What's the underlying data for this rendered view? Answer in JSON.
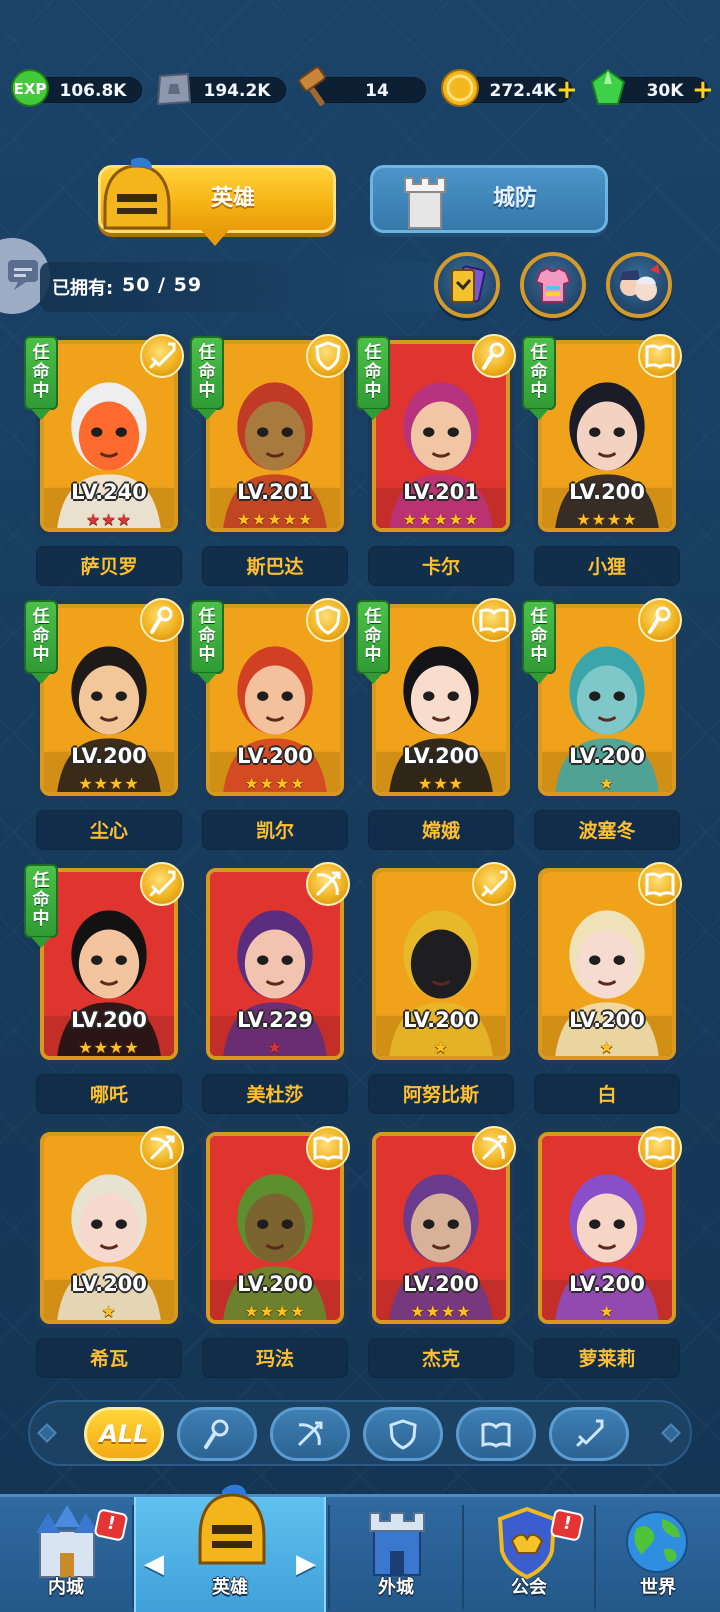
{
  "resources": [
    {
      "id": "exp",
      "value": "106.8K",
      "plus": false,
      "color": "#4fd43a"
    },
    {
      "id": "stone",
      "value": "194.2K",
      "plus": false,
      "color": "#9aa4b8"
    },
    {
      "id": "hammer",
      "value": "14",
      "plus": false,
      "color": "#c8863a"
    },
    {
      "id": "gold",
      "value": "272.4K",
      "plus": true,
      "color": "#f2b81e"
    },
    {
      "id": "gem",
      "value": "30K",
      "plus": true,
      "color": "#3fd04a"
    }
  ],
  "plus_symbol": "+",
  "tabs": {
    "heroes": "英雄",
    "defense": "城防"
  },
  "owned": {
    "label": "已拥有:",
    "value": "50 / 59"
  },
  "appointed_label": "任命中",
  "star_glyph": "★",
  "heroes": [
    {
      "name": "萨贝罗",
      "level": "LV.240",
      "stars": 3,
      "star_color": "#e0303c",
      "class": "sword",
      "appointed": true,
      "bg": "#f0a31a",
      "skin": "#ff6a2e",
      "hair": "#eeeeee"
    },
    {
      "name": "斯巴达",
      "level": "LV.201",
      "stars": 5,
      "star_color": "#ffc21a",
      "class": "shield",
      "appointed": true,
      "bg": "#f0a31a",
      "skin": "#a87a3e",
      "hair": "#c03a26"
    },
    {
      "name": "卡尔",
      "level": "LV.201",
      "stars": 5,
      "star_color": "#ffc21a",
      "class": "staff",
      "appointed": true,
      "bg": "#e0352e",
      "skin": "#f0c6a4",
      "hair": "#b8337e"
    },
    {
      "name": "小狸",
      "level": "LV.200",
      "stars": 4,
      "star_color": "#ffc21a",
      "class": "book",
      "appointed": true,
      "bg": "#f0a31a",
      "skin": "#f4d2c2",
      "hair": "#1c1c28"
    },
    {
      "name": "尘心",
      "level": "LV.200",
      "stars": 4,
      "star_color": "#ffc21a",
      "class": "staff",
      "appointed": true,
      "bg": "#f0a31a",
      "skin": "#f2c79a",
      "hair": "#1e1a18"
    },
    {
      "name": "凯尔",
      "level": "LV.200",
      "stars": 4,
      "star_color": "#ffc21a",
      "class": "shield",
      "appointed": true,
      "bg": "#f0a31a",
      "skin": "#f3c29c",
      "hair": "#d24024"
    },
    {
      "name": "嫦娥",
      "level": "LV.200",
      "stars": 3,
      "star_color": "#ffc21a",
      "class": "book",
      "appointed": true,
      "bg": "#f0a31a",
      "skin": "#f8dccc",
      "hair": "#141418"
    },
    {
      "name": "波塞冬",
      "level": "LV.200",
      "stars": 1,
      "star_color": "#ffc21a",
      "class": "staff",
      "appointed": true,
      "bg": "#f0a31a",
      "skin": "#7fc7c8",
      "hair": "#3aa6ac"
    },
    {
      "name": "哪吒",
      "level": "LV.200",
      "stars": 4,
      "star_color": "#ffc21a",
      "class": "sword",
      "appointed": true,
      "bg": "#e0352e",
      "skin": "#f4c49e",
      "hair": "#121212"
    },
    {
      "name": "美杜莎",
      "level": "LV.229",
      "stars": 1,
      "star_color": "#e0303c",
      "class": "bow",
      "appointed": false,
      "bg": "#e0352e",
      "skin": "#f2c4b0",
      "hair": "#5a2d7e"
    },
    {
      "name": "阿努比斯",
      "level": "LV.200",
      "stars": 1,
      "star_color": "#ffc21a",
      "class": "sword",
      "appointed": false,
      "bg": "#f0a31a",
      "skin": "#1e1e22",
      "hair": "#e7b82a"
    },
    {
      "name": "白",
      "level": "LV.200",
      "stars": 1,
      "star_color": "#ffc21a",
      "class": "book",
      "appointed": false,
      "bg": "#f0a31a",
      "skin": "#f6dcd0",
      "hair": "#efe2b8"
    },
    {
      "name": "希瓦",
      "level": "LV.200",
      "stars": 1,
      "star_color": "#ffc21a",
      "class": "bow",
      "appointed": false,
      "bg": "#f0a31a",
      "skin": "#f6d8cc",
      "hair": "#e8e2d0"
    },
    {
      "name": "玛法",
      "level": "LV.200",
      "stars": 4,
      "star_color": "#ffc21a",
      "class": "book",
      "appointed": false,
      "bg": "#e0352e",
      "skin": "#7c6430",
      "hair": "#5e8f2e"
    },
    {
      "name": "杰克",
      "level": "LV.200",
      "stars": 4,
      "star_color": "#ffc21a",
      "class": "bow",
      "appointed": false,
      "bg": "#e0352e",
      "skin": "#d8b298",
      "hair": "#6a3a8c"
    },
    {
      "name": "萝莱莉",
      "level": "LV.200",
      "stars": 1,
      "star_color": "#ffc21a",
      "class": "book",
      "appointed": false,
      "bg": "#e0352e",
      "skin": "#f6d4c6",
      "hair": "#8a4ec8"
    }
  ],
  "filters": [
    {
      "id": "all",
      "label": "ALL",
      "active": true
    },
    {
      "id": "staff",
      "label": "",
      "active": false
    },
    {
      "id": "bow",
      "label": "",
      "active": false
    },
    {
      "id": "shield",
      "label": "",
      "active": false
    },
    {
      "id": "book",
      "label": "",
      "active": false
    },
    {
      "id": "sword",
      "label": "",
      "active": false
    }
  ],
  "nav": {
    "inner_city": "内城",
    "heroes": "英雄",
    "outer_city": "外城",
    "guild": "公会",
    "world": "世界",
    "alert_symbol": "!",
    "arrow_left": "◀",
    "arrow_right": "▶"
  },
  "colors": {
    "accent_gold": "#f6b514",
    "name_text": "#ffbf2e",
    "appointed_green": "#2f9c34"
  }
}
